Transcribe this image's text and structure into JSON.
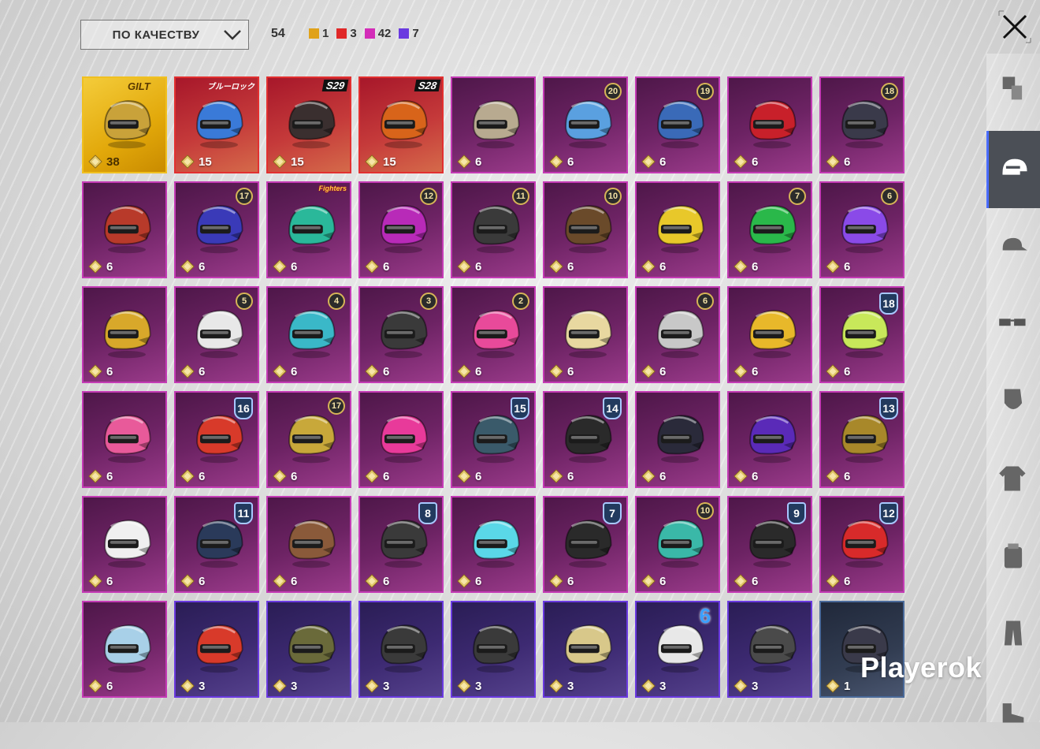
{
  "header": {
    "sort_label": "ПО КАЧЕСТВУ",
    "total_count": "54",
    "legend": [
      {
        "color": "#e0a21a",
        "count": "1"
      },
      {
        "color": "#e02828",
        "count": "3"
      },
      {
        "color": "#d32db8",
        "count": "42"
      },
      {
        "color": "#6a3ae0",
        "count": "7"
      }
    ]
  },
  "sidebar": {
    "tabs": [
      {
        "icon": "outfit-icon",
        "active": false
      },
      {
        "icon": "helmet-icon",
        "active": true
      },
      {
        "icon": "cap-icon",
        "active": false
      },
      {
        "icon": "glasses-icon",
        "active": false
      },
      {
        "icon": "mask-icon",
        "active": false
      },
      {
        "icon": "jacket-icon",
        "active": false
      },
      {
        "icon": "backpack-icon",
        "active": false
      },
      {
        "icon": "pants-icon",
        "active": false
      },
      {
        "icon": "shoes-icon",
        "active": false
      }
    ]
  },
  "items": [
    {
      "rarity": "legendary",
      "points": "38",
      "logo": "GILT",
      "logo_style": "gilt",
      "color": "#c9a23a"
    },
    {
      "rarity": "mythic",
      "points": "15",
      "logo": "ブルーロック",
      "color": "#3a7ad8"
    },
    {
      "rarity": "mythic",
      "points": "15",
      "season": "S29",
      "color": "#3a2f2f"
    },
    {
      "rarity": "mythic",
      "points": "15",
      "season": "S28",
      "color": "#d8641a"
    },
    {
      "rarity": "epic",
      "points": "6",
      "color": "#b8aa90"
    },
    {
      "rarity": "epic",
      "points": "6",
      "level": "20",
      "color": "#5aa0e0"
    },
    {
      "rarity": "epic",
      "points": "6",
      "level": "19",
      "color": "#3a6ab8"
    },
    {
      "rarity": "epic",
      "points": "6",
      "color": "#c8202a"
    },
    {
      "rarity": "epic",
      "points": "6",
      "level": "18",
      "color": "#3a3a4a"
    },
    {
      "rarity": "epic",
      "points": "6",
      "color": "#b83a2a"
    },
    {
      "rarity": "epic",
      "points": "6",
      "level": "17",
      "color": "#3a3ab8"
    },
    {
      "rarity": "epic",
      "points": "6",
      "logo": "Fighters",
      "logo_style": "kof",
      "color": "#2ab89a"
    },
    {
      "rarity": "epic",
      "points": "6",
      "level": "12",
      "color": "#b82ab8"
    },
    {
      "rarity": "epic",
      "points": "6",
      "level": "11",
      "color": "#3a3a3a"
    },
    {
      "rarity": "epic",
      "points": "6",
      "level": "10",
      "color": "#6a4a2a"
    },
    {
      "rarity": "epic",
      "points": "6",
      "color": "#e8c82a"
    },
    {
      "rarity": "epic",
      "points": "6",
      "level": "7",
      "color": "#2ab84a"
    },
    {
      "rarity": "epic",
      "points": "6",
      "level": "6",
      "color": "#8a4ae8"
    },
    {
      "rarity": "epic",
      "points": "6",
      "color": "#d8a82a"
    },
    {
      "rarity": "epic",
      "points": "6",
      "level": "5",
      "color": "#e8e8e8"
    },
    {
      "rarity": "epic",
      "points": "6",
      "level": "4",
      "color": "#3ab8c8"
    },
    {
      "rarity": "epic",
      "points": "6",
      "level": "3",
      "color": "#3a3a3a"
    },
    {
      "rarity": "epic",
      "points": "6",
      "level": "2",
      "color": "#e84a9a"
    },
    {
      "rarity": "epic",
      "points": "6",
      "color": "#e8d8a0"
    },
    {
      "rarity": "epic",
      "points": "6",
      "level": "6",
      "color": "#c8c8c8"
    },
    {
      "rarity": "epic",
      "points": "6",
      "color": "#e8b82a"
    },
    {
      "rarity": "epic",
      "points": "6",
      "level": "18",
      "level_style": "shield",
      "color": "#c8e85a"
    },
    {
      "rarity": "epic",
      "points": "6",
      "color": "#e85a9a"
    },
    {
      "rarity": "epic",
      "points": "6",
      "level": "16",
      "level_style": "shield",
      "color": "#d83a2a"
    },
    {
      "rarity": "epic",
      "points": "6",
      "level": "17",
      "color": "#c8a83a"
    },
    {
      "rarity": "epic",
      "points": "6",
      "color": "#e83a9a"
    },
    {
      "rarity": "epic",
      "points": "6",
      "level": "15",
      "level_style": "shield",
      "color": "#3a5a6a"
    },
    {
      "rarity": "epic",
      "points": "6",
      "level": "14",
      "level_style": "shield",
      "color": "#2a2a2a"
    },
    {
      "rarity": "epic",
      "points": "6",
      "color": "#2a2a3a"
    },
    {
      "rarity": "epic",
      "points": "6",
      "color": "#5a2ab8"
    },
    {
      "rarity": "epic",
      "points": "6",
      "level": "13",
      "level_style": "shield",
      "color": "#a8882a"
    },
    {
      "rarity": "epic",
      "points": "6",
      "color": "#f0f0f0"
    },
    {
      "rarity": "epic",
      "points": "6",
      "level": "11",
      "level_style": "shield",
      "color": "#2a3a5a"
    },
    {
      "rarity": "epic",
      "points": "6",
      "color": "#8a5a3a"
    },
    {
      "rarity": "epic",
      "points": "6",
      "level": "8",
      "level_style": "shield",
      "color": "#3a3a3a"
    },
    {
      "rarity": "epic",
      "points": "6",
      "color": "#5ad8e8"
    },
    {
      "rarity": "epic",
      "points": "6",
      "level": "7",
      "level_style": "shield",
      "color": "#2a2a2a"
    },
    {
      "rarity": "epic",
      "points": "6",
      "level": "10",
      "color": "#3ab8a8"
    },
    {
      "rarity": "epic",
      "points": "6",
      "level": "9",
      "level_style": "shield",
      "color": "#2a2a2a"
    },
    {
      "rarity": "epic",
      "points": "6",
      "level": "12",
      "level_style": "shield",
      "color": "#d82a2a"
    },
    {
      "rarity": "epic",
      "points": "6",
      "color": "#a8d0e8"
    },
    {
      "rarity": "rare",
      "points": "3",
      "color": "#d83a2a"
    },
    {
      "rarity": "rare",
      "points": "3",
      "color": "#6a6a3a"
    },
    {
      "rarity": "rare",
      "points": "3",
      "color": "#3a3a3a"
    },
    {
      "rarity": "rare",
      "points": "3",
      "color": "#3a3a3a"
    },
    {
      "rarity": "rare",
      "points": "3",
      "color": "#d8c88a"
    },
    {
      "rarity": "rare",
      "points": "3",
      "level": "6",
      "level_style": "bigblue",
      "color": "#e8e8e8"
    },
    {
      "rarity": "rare",
      "points": "3",
      "color": "#4a4a4a"
    },
    {
      "rarity": "common",
      "points": "1",
      "color": "#3a3a4a"
    }
  ],
  "watermark": "Playerok"
}
